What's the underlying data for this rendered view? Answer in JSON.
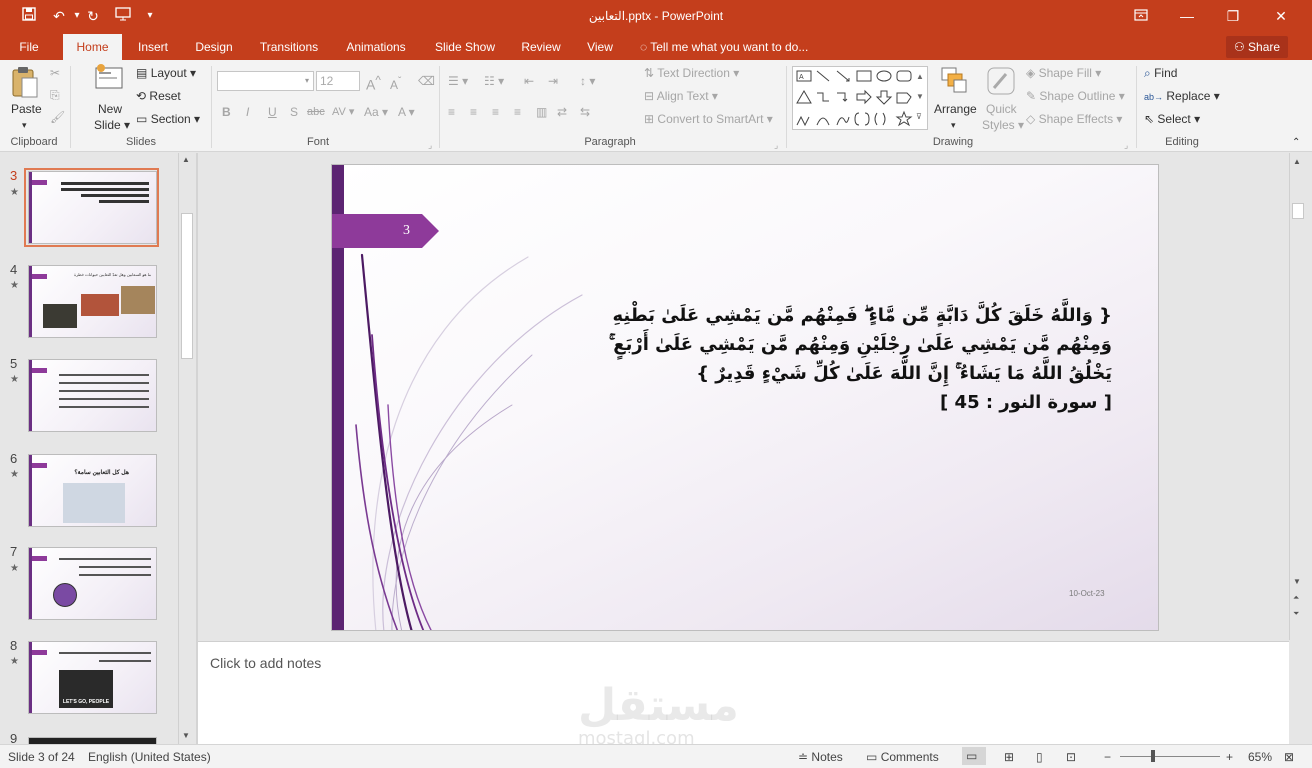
{
  "titlebar": {
    "title": "التعابين.pptx - PowerPoint",
    "restore_icon": "ribbon-display-icon",
    "minimize": "—",
    "maximize": "❐",
    "close": "✕"
  },
  "tabs": [
    {
      "label": "File"
    },
    {
      "label": "Home"
    },
    {
      "label": "Insert"
    },
    {
      "label": "Design"
    },
    {
      "label": "Transitions"
    },
    {
      "label": "Animations"
    },
    {
      "label": "Slide Show"
    },
    {
      "label": "Review"
    },
    {
      "label": "View"
    }
  ],
  "tellme": "Tell me what you want to do...",
  "share": "Share",
  "ribbon": {
    "clipboard": {
      "paste": "Paste",
      "group": "Clipboard"
    },
    "slides": {
      "new_slide_1": "New",
      "new_slide_2": "Slide",
      "layout": "Layout",
      "reset": "Reset",
      "section": "Section",
      "group": "Slides"
    },
    "font": {
      "size": "12",
      "group": "Font",
      "bold": "B",
      "italic": "I",
      "underline": "U",
      "shadow": "S",
      "strike": "abc",
      "spacing": "AV",
      "case": "Aa",
      "grow": "A",
      "shrink": "A"
    },
    "paragraph": {
      "text_direction": "Text Direction",
      "align_text": "Align Text",
      "convert": "Convert to SmartArt",
      "group": "Paragraph"
    },
    "drawing": {
      "arrange": "Arrange",
      "quick_styles_1": "Quick",
      "quick_styles_2": "Styles",
      "shape_fill": "Shape Fill",
      "shape_outline": "Shape Outline",
      "shape_effects": "Shape Effects",
      "group": "Drawing"
    },
    "editing": {
      "find": "Find",
      "replace": "Replace",
      "select": "Select",
      "group": "Editing"
    }
  },
  "thumbnails": [
    {
      "num": "3"
    },
    {
      "num": "4",
      "title": "ما هو السعابين وهل تعدّ الثعابين حيوانات خطرة"
    },
    {
      "num": "5"
    },
    {
      "num": "6",
      "title": "هل كل الثعابين سامة؟"
    },
    {
      "num": "7"
    },
    {
      "num": "8",
      "caption": "LET'S GO, PEOPLE"
    },
    {
      "num": "9"
    }
  ],
  "slide": {
    "number": "3",
    "verse_lines": [
      "{ وَاللَّهُ خَلَقَ كُلَّ دَابَّةٍ مِّن مَّاءٍ ۖ فَمِنْهُم مَّن يَمْشِي عَلَىٰ بَطْنِهِ",
      "وَمِنْهُم مَّن يَمْشِي عَلَىٰ رِجْلَيْنِ وَمِنْهُم مَّن يَمْشِي عَلَىٰ أَرْبَعٍ ۚ",
      "يَخْلُقُ اللَّهُ مَا يَشَاءُ ۚ إِنَّ اللَّهَ عَلَىٰ كُلِّ شَيْءٍ قَدِيرٌ }",
      "[ سورة النور : 45 ]"
    ],
    "date": "10-Oct-23"
  },
  "notes_placeholder": "Click to add notes",
  "watermark": {
    "arabic": "مستقل",
    "latin": "mostaql.com"
  },
  "status": {
    "slide_of": "Slide 3 of 24",
    "language": "English (United States)",
    "notes": "Notes",
    "comments": "Comments",
    "zoom": "65%"
  },
  "colors": {
    "accent": "#c43e1c",
    "slide_bar": "#5c2472",
    "tag": "#8e3a9a"
  }
}
